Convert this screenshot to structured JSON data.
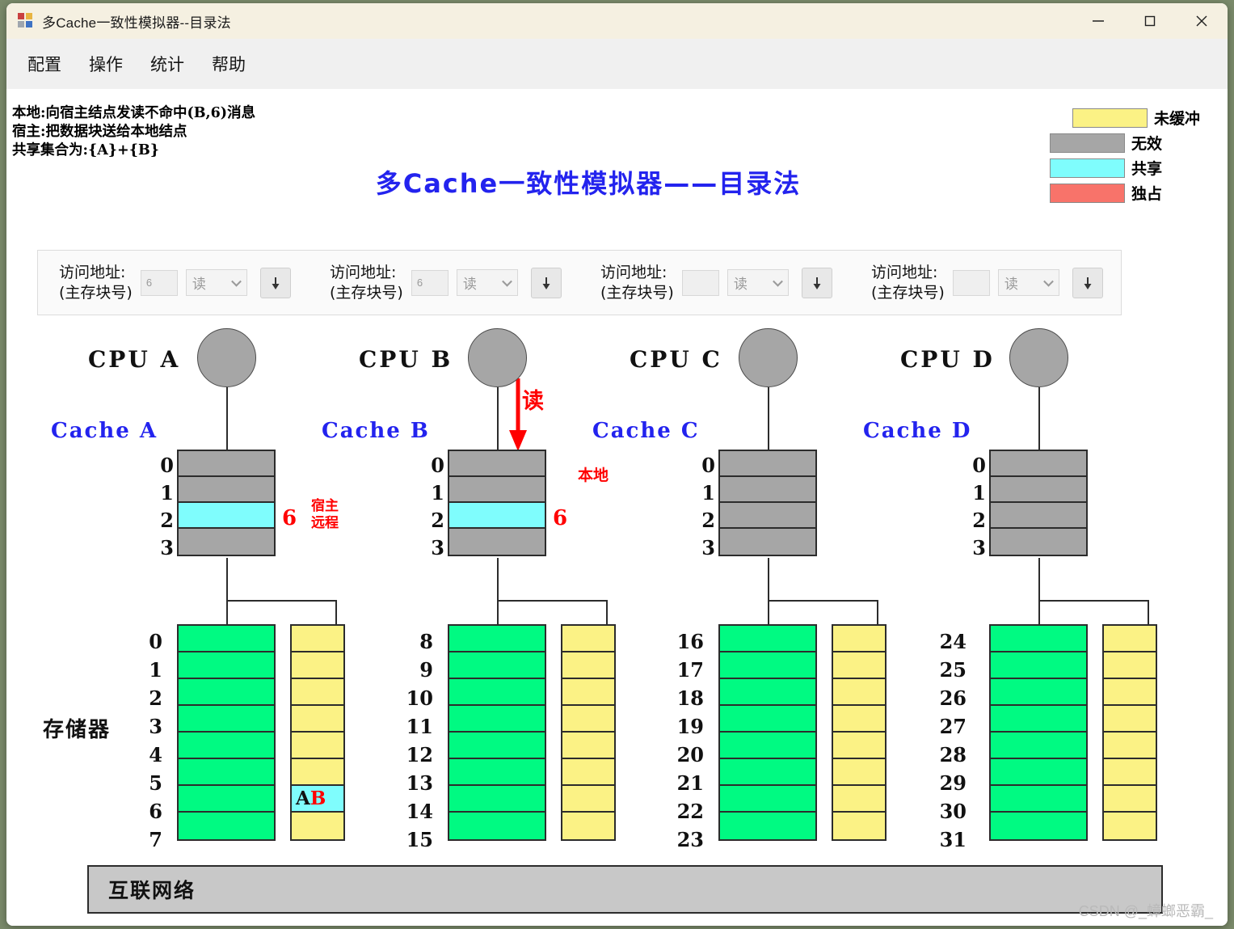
{
  "window": {
    "title": "多Cache一致性模拟器--目录法",
    "icon": "app-window-icon",
    "minimize": "—",
    "maximize": "□",
    "close": "✕"
  },
  "menu": {
    "items": [
      {
        "label": "配置"
      },
      {
        "label": "操作"
      },
      {
        "label": "统计"
      },
      {
        "label": "帮助"
      }
    ]
  },
  "status": {
    "line1": "本地:向宿主结点发读不命中(B,6)消息",
    "line2": "宿主:把数据块送给本地结点",
    "line3": "共享集合为:{A}+{B}"
  },
  "legend": {
    "items": [
      {
        "label": "未缓冲",
        "color": "#fbf285",
        "indent": true
      },
      {
        "label": "无效",
        "color": "#a6a6a6",
        "indent": false
      },
      {
        "label": "共享",
        "color": "#7ffdfd",
        "indent": false
      },
      {
        "label": "独占",
        "color": "#f8736a",
        "indent": false
      }
    ]
  },
  "heading": {
    "title": "多Cache一致性模拟器——目录法",
    "color": "#2323ee"
  },
  "input_panel": {
    "groups": [
      {
        "label_line1": "访问地址:",
        "label_line2": "(主存块号)",
        "value": "6",
        "op": "读",
        "button": "step-down-button"
      },
      {
        "label_line1": "访问地址:",
        "label_line2": "(主存块号)",
        "value": "6",
        "op": "读",
        "button": "step-down-button"
      },
      {
        "label_line1": "访问地址:",
        "label_line2": "(主存块号)",
        "value": "",
        "op": "读",
        "button": "step-down-button"
      },
      {
        "label_line1": "访问地址:",
        "label_line2": "(主存块号)",
        "value": "",
        "op": "读",
        "button": "step-down-button"
      }
    ]
  },
  "memory_master_label": "存储器",
  "network": {
    "label": "互联网络"
  },
  "read_marker": {
    "label": "读"
  },
  "nodes": [
    {
      "cpu": "CPU A",
      "cache_label": "Cache A",
      "cache_rows": [
        {
          "index": "0",
          "state": "invalid",
          "value": ""
        },
        {
          "index": "1",
          "state": "invalid",
          "value": ""
        },
        {
          "index": "2",
          "state": "shared",
          "value": "6"
        },
        {
          "index": "3",
          "state": "invalid",
          "value": ""
        }
      ],
      "note": "宿主\n远程",
      "note_line1": "宿主",
      "note_line2": "远程",
      "mem_indices": [
        "0",
        "1",
        "2",
        "3",
        "4",
        "5",
        "6",
        "7"
      ],
      "dir_cells": [
        {
          "state": "uncached",
          "tokens": []
        },
        {
          "state": "uncached",
          "tokens": []
        },
        {
          "state": "uncached",
          "tokens": []
        },
        {
          "state": "uncached",
          "tokens": []
        },
        {
          "state": "uncached",
          "tokens": []
        },
        {
          "state": "uncached",
          "tokens": []
        },
        {
          "state": "shared",
          "tokens": [
            {
              "text": "A",
              "color": "black"
            },
            {
              "text": "B",
              "color": "red"
            }
          ]
        },
        {
          "state": "uncached",
          "tokens": []
        }
      ]
    },
    {
      "cpu": "CPU B",
      "cache_label": "Cache B",
      "cache_rows": [
        {
          "index": "0",
          "state": "invalid",
          "value": ""
        },
        {
          "index": "1",
          "state": "invalid",
          "value": ""
        },
        {
          "index": "2",
          "state": "shared",
          "value": "6"
        },
        {
          "index": "3",
          "state": "invalid",
          "value": ""
        }
      ],
      "note_line1": "本地",
      "note_line2": "",
      "mem_indices": [
        "8",
        "9",
        "10",
        "11",
        "12",
        "13",
        "14",
        "15"
      ],
      "dir_cells": [
        {
          "state": "uncached",
          "tokens": []
        },
        {
          "state": "uncached",
          "tokens": []
        },
        {
          "state": "uncached",
          "tokens": []
        },
        {
          "state": "uncached",
          "tokens": []
        },
        {
          "state": "uncached",
          "tokens": []
        },
        {
          "state": "uncached",
          "tokens": []
        },
        {
          "state": "uncached",
          "tokens": []
        },
        {
          "state": "uncached",
          "tokens": []
        }
      ]
    },
    {
      "cpu": "CPU C",
      "cache_label": "Cache C",
      "cache_rows": [
        {
          "index": "0",
          "state": "invalid",
          "value": ""
        },
        {
          "index": "1",
          "state": "invalid",
          "value": ""
        },
        {
          "index": "2",
          "state": "invalid",
          "value": ""
        },
        {
          "index": "3",
          "state": "invalid",
          "value": ""
        }
      ],
      "note_line1": "",
      "note_line2": "",
      "mem_indices": [
        "16",
        "17",
        "18",
        "19",
        "20",
        "21",
        "22",
        "23"
      ],
      "dir_cells": [
        {
          "state": "uncached",
          "tokens": []
        },
        {
          "state": "uncached",
          "tokens": []
        },
        {
          "state": "uncached",
          "tokens": []
        },
        {
          "state": "uncached",
          "tokens": []
        },
        {
          "state": "uncached",
          "tokens": []
        },
        {
          "state": "uncached",
          "tokens": []
        },
        {
          "state": "uncached",
          "tokens": []
        },
        {
          "state": "uncached",
          "tokens": []
        }
      ]
    },
    {
      "cpu": "CPU D",
      "cache_label": "Cache D",
      "cache_rows": [
        {
          "index": "0",
          "state": "invalid",
          "value": ""
        },
        {
          "index": "1",
          "state": "invalid",
          "value": ""
        },
        {
          "index": "2",
          "state": "invalid",
          "value": ""
        },
        {
          "index": "3",
          "state": "invalid",
          "value": ""
        }
      ],
      "note_line1": "",
      "note_line2": "",
      "mem_indices": [
        "24",
        "25",
        "26",
        "27",
        "28",
        "29",
        "30",
        "31"
      ],
      "dir_cells": [
        {
          "state": "uncached",
          "tokens": []
        },
        {
          "state": "uncached",
          "tokens": []
        },
        {
          "state": "uncached",
          "tokens": []
        },
        {
          "state": "uncached",
          "tokens": []
        },
        {
          "state": "uncached",
          "tokens": []
        },
        {
          "state": "uncached",
          "tokens": []
        },
        {
          "state": "uncached",
          "tokens": []
        },
        {
          "state": "uncached",
          "tokens": []
        }
      ]
    }
  ],
  "watermark": "CSDN @_蟑螂恶霸_",
  "colors": {
    "uncached": "#fbf285",
    "invalid": "#a6a6a6",
    "shared": "#7ffdfd",
    "exclusive": "#f8736a",
    "memory": "#00fa82",
    "accent_blue": "#2323ee",
    "accent_red": "#ff0000"
  }
}
